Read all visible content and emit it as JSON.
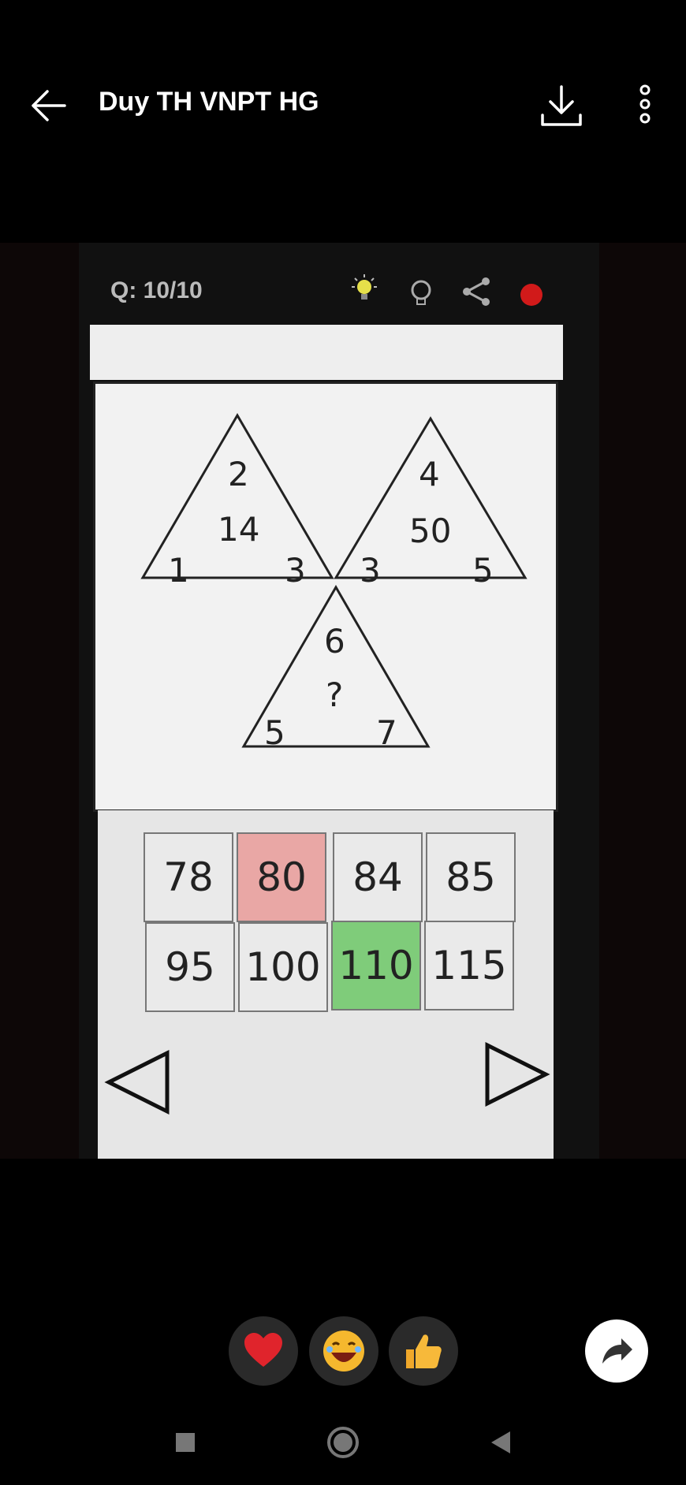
{
  "header": {
    "title": "Duy TH VNPT HG"
  },
  "quiz": {
    "question_counter": "Q: 10/10",
    "triangles": [
      {
        "top": "2",
        "center": "14",
        "left": "1",
        "right": "3"
      },
      {
        "top": "4",
        "center": "50",
        "left": "3",
        "right": "5"
      },
      {
        "top": "6",
        "center": "?",
        "left": "5",
        "right": "7"
      }
    ],
    "answers": [
      {
        "label": "78",
        "state": "normal"
      },
      {
        "label": "80",
        "state": "wrong"
      },
      {
        "label": "84",
        "state": "normal"
      },
      {
        "label": "85",
        "state": "normal"
      },
      {
        "label": "95",
        "state": "normal"
      },
      {
        "label": "100",
        "state": "normal"
      },
      {
        "label": "110",
        "state": "correct"
      },
      {
        "label": "115",
        "state": "normal"
      }
    ]
  },
  "reactions": [
    "heart-icon",
    "laughing-face-icon",
    "thumbs-up-icon"
  ],
  "colors": {
    "wrong": "#e9a7a5",
    "correct": "#7fcc7a",
    "hint_bulb": "#e6e04a",
    "record_dot": "#d11a1a"
  }
}
